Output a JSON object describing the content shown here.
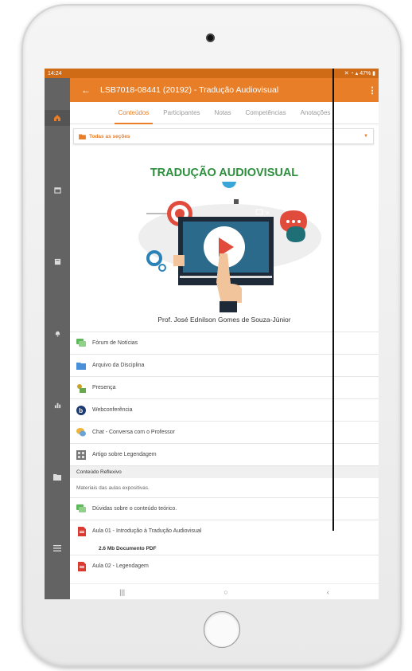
{
  "status": {
    "time": "14:24",
    "right": "47%"
  },
  "appbar": {
    "title": "LSB7018-08441 (20192) - Tradução Audiovisual"
  },
  "tabs": [
    {
      "label": "Conteúdos"
    },
    {
      "label": "Participantes"
    },
    {
      "label": "Notas"
    },
    {
      "label": "Competências"
    },
    {
      "label": "Anotações"
    }
  ],
  "filter": {
    "label": "Todas as seções"
  },
  "banner": {
    "title": "TRADUÇÃO AUDIOVISUAL",
    "professor": "Prof. José Ednilson Gomes de Souza-Júnior"
  },
  "items": [
    {
      "label": "Fórum de Notícias",
      "icon": "forum-icon"
    },
    {
      "label": "Arquivo da Disciplina",
      "icon": "folder-icon"
    },
    {
      "label": "Presença",
      "icon": "attendance-icon"
    },
    {
      "label": "Webconferência",
      "icon": "webconference-icon"
    },
    {
      "label": "Chat - Conversa com o Professor",
      "icon": "chat-icon"
    },
    {
      "label": "Artigo sobre Legendagem",
      "icon": "article-icon"
    }
  ],
  "section": {
    "title": "Conteúdo Reflexivo",
    "description": "Materiais das aulas expositivas.",
    "items": [
      {
        "label": "Dúvidas sobre o conteúdo teórico.",
        "icon": "forum-icon"
      },
      {
        "label": "Aula 01 - Introdução à Tradução Audiovisual",
        "icon": "pdf-icon",
        "meta": "2.6 Mb Documento PDF"
      },
      {
        "label": "Aula 02 - Legendagem",
        "icon": "pdf-icon"
      }
    ]
  },
  "navbar": {
    "recent": "|||",
    "home": "○",
    "back": "‹"
  },
  "colors": {
    "accent": "#e87e27",
    "rail": "#636363",
    "title_green": "#2c8f3c"
  }
}
